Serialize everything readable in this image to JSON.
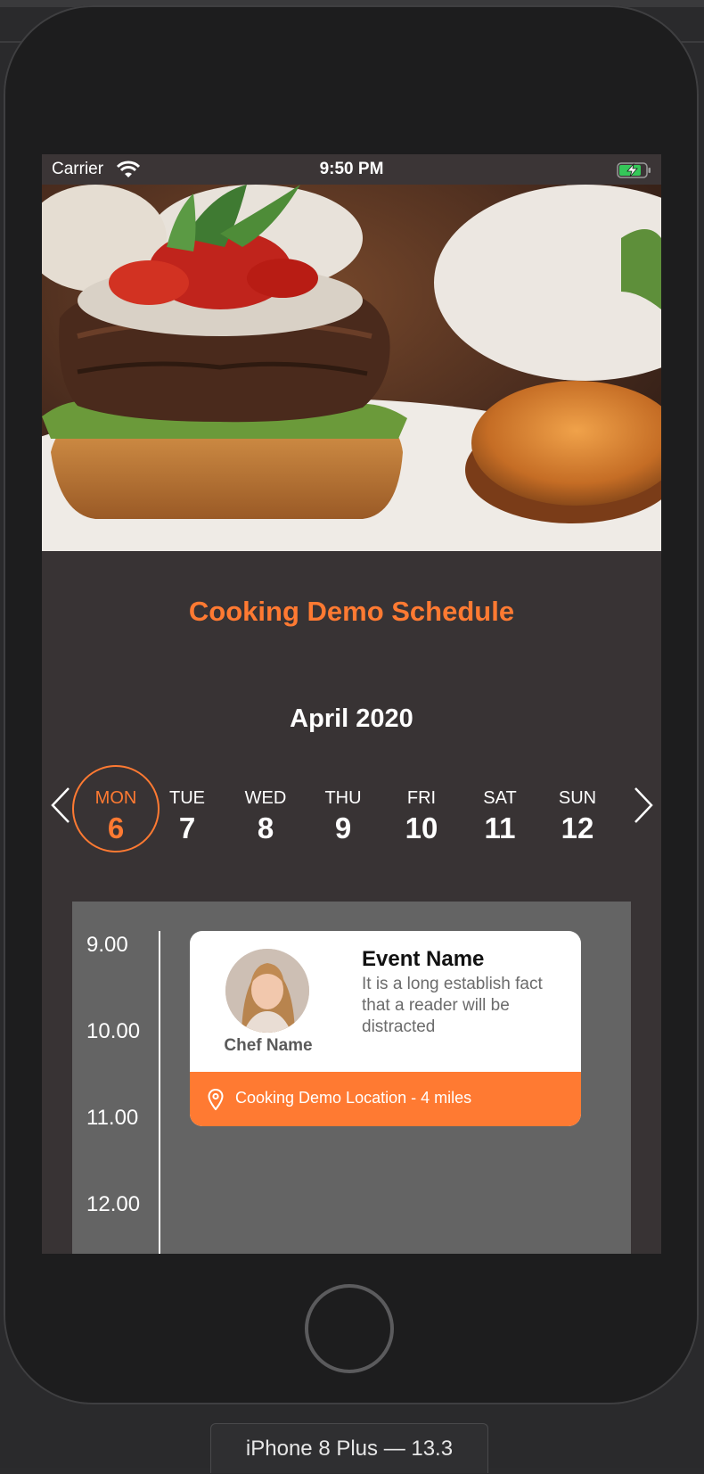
{
  "status_bar": {
    "carrier": "Carrier",
    "time": "9:50 PM",
    "icons": [
      "wifi-icon",
      "battery-charging-icon"
    ]
  },
  "hero_image": {
    "description_icon": "burger-photo"
  },
  "schedule": {
    "title": "Cooking Demo Schedule",
    "month": "April 2020",
    "days": [
      {
        "name": "MON",
        "number": "6",
        "selected": true
      },
      {
        "name": "TUE",
        "number": "7",
        "selected": false
      },
      {
        "name": "WED",
        "number": "8",
        "selected": false
      },
      {
        "name": "THU",
        "number": "9",
        "selected": false
      },
      {
        "name": "FRI",
        "number": "10",
        "selected": false
      },
      {
        "name": "SAT",
        "number": "11",
        "selected": false
      },
      {
        "name": "SUN",
        "number": "12",
        "selected": false
      }
    ],
    "times": [
      "9.00",
      "10.00",
      "11.00",
      "12.00"
    ]
  },
  "event": {
    "name": "Event Name",
    "description": "It is a long establish fact that a reader will be distracted",
    "chef_name": "Chef Name",
    "location": "Cooking Demo Location - 4 miles"
  },
  "device": {
    "label": "iPhone 8 Plus — 13.3"
  },
  "colors": {
    "accent": "#ff7a32",
    "panel": "#646464",
    "screen_bg": "#383334"
  }
}
